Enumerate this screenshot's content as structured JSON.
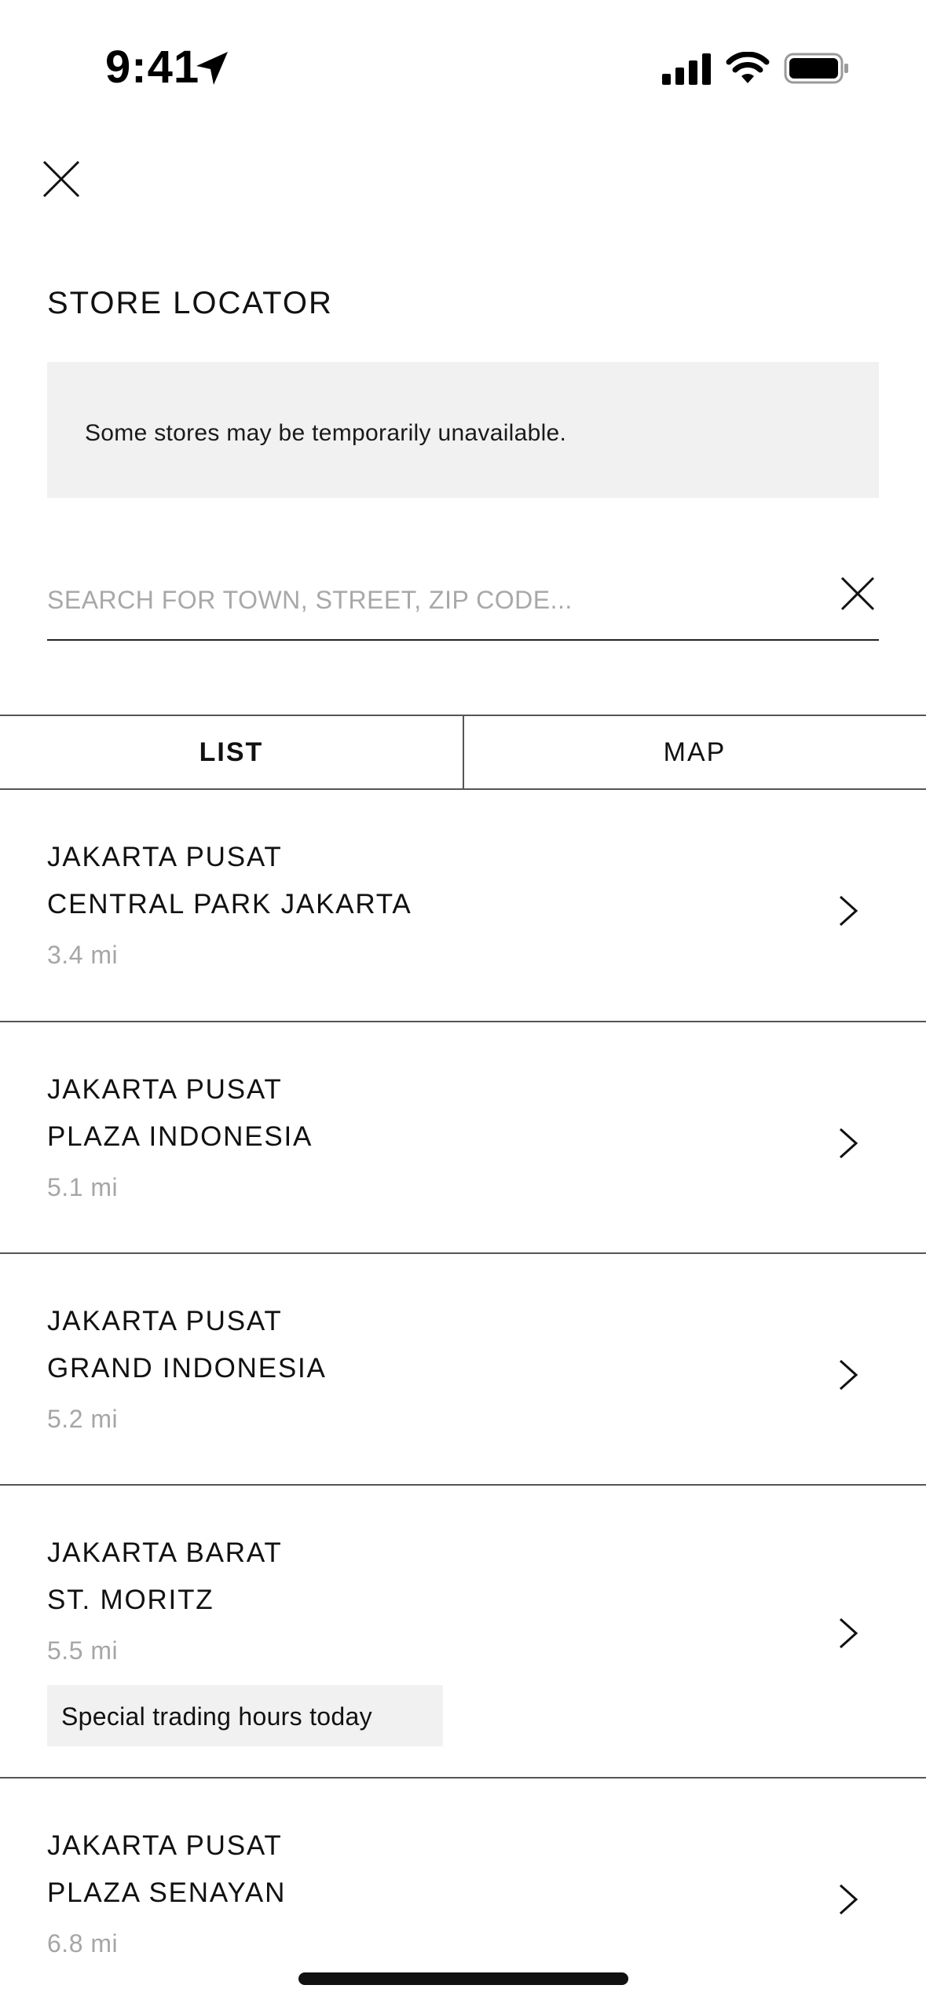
{
  "status_bar": {
    "time": "9:41",
    "icons": [
      "location-arrow-icon",
      "cellular-signal-icon",
      "wifi-icon",
      "battery-icon"
    ]
  },
  "header": {
    "close_icon": "close-icon",
    "title": "STORE LOCATOR"
  },
  "notice": {
    "text": "Some stores may be temporarily unavailable."
  },
  "search": {
    "value": "",
    "placeholder": "SEARCH FOR TOWN, STREET, ZIP CODE...",
    "clear_icon": "close-icon"
  },
  "tabs": [
    {
      "label": "LIST",
      "selected": true
    },
    {
      "label": "MAP",
      "selected": false
    }
  ],
  "stores": [
    {
      "region": "JAKARTA PUSAT",
      "name": "CENTRAL PARK JAKARTA",
      "distance": "3.4 mi"
    },
    {
      "region": "JAKARTA PUSAT",
      "name": "PLAZA INDONESIA",
      "distance": "5.1 mi"
    },
    {
      "region": "JAKARTA PUSAT",
      "name": "GRAND INDONESIA",
      "distance": "5.2 mi"
    },
    {
      "region": "JAKARTA BARAT",
      "name": "ST. MORITZ",
      "distance": "5.5 mi",
      "badge": "Special trading hours today"
    },
    {
      "region": "JAKARTA PUSAT",
      "name": "PLAZA SENAYAN",
      "distance": "6.8 mi"
    }
  ],
  "colors": {
    "background": "#ffffff",
    "text": "#111111",
    "muted_text": "#a6a6a6",
    "panel": "#f1f1f1",
    "divider": "#555555"
  }
}
